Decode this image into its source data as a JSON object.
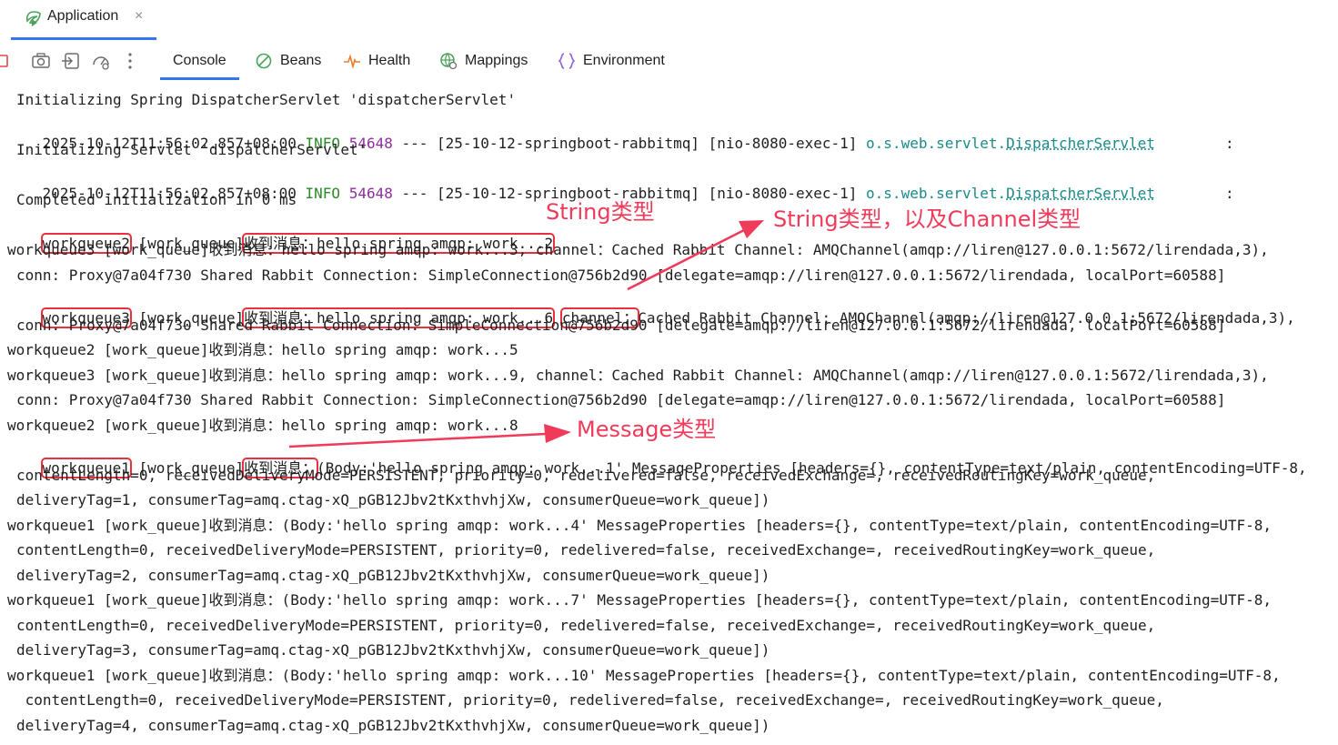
{
  "app_tab": {
    "title": "Application",
    "close": "×"
  },
  "tabs": [
    {
      "label": "Console",
      "icon": "none"
    },
    {
      "label": "Beans",
      "icon": "beans-icon"
    },
    {
      "label": "Health",
      "icon": "health-icon"
    },
    {
      "label": "Mappings",
      "icon": "mappings-icon"
    },
    {
      "label": "Environment",
      "icon": "environment-icon"
    }
  ],
  "colors": {
    "accent": "#3574f0",
    "info": "#2a8a2a",
    "pid": "#8e2f9e",
    "logger": "#1b8a8a",
    "highlight": "#e8313f",
    "annotation": "#f03a5a"
  },
  "console": {
    "l0": "Initializing Spring DispatcherServlet 'dispatcherServlet'",
    "log1": {
      "ts": "2025-10-12T11:56:02.857+08:00",
      "level": " INFO",
      "pid": " 54648",
      "mid": " --- [25-10-12-springboot-rabbitmq] [nio-8080-exec-1] ",
      "logger_pkg": "o.s.web.servlet.",
      "logger_cls": "DispatcherServlet",
      "colon": "        :"
    },
    "l2": "Initializing Servlet 'dispatcherServlet'",
    "log2": {
      "ts": "2025-10-12T11:56:02.857+08:00",
      "level": " INFO",
      "pid": " 54648",
      "mid": " --- [25-10-12-springboot-rabbitmq] [nio-8080-exec-1] ",
      "logger_pkg": "o.s.web.servlet.",
      "logger_cls": "DispatcherServlet",
      "colon": "        :"
    },
    "l4": "Completed initialization in 0 ms",
    "l5": {
      "a": "workqueue2",
      "b": " [work_queue]",
      "c": "收到消息：hello spring amqp: work...2"
    },
    "l6": "workqueue3 [work_queue]收到消息：hello spring amqp: work...3, channel：Cached Rabbit Channel: AMQChannel(amqp://liren@127.0.0.1:5672/lirendada,3),",
    "l7": "conn: Proxy@7a04f730 Shared Rabbit Connection: SimpleConnection@756b2d90 [delegate=amqp://liren@127.0.0.1:5672/lirendada, localPort=60588]",
    "l8": {
      "a": "workqueue3",
      "b": " [work_queue]",
      "c": "收到消息：hello spring amqp: work...6",
      "d": " ",
      "e": "channel：",
      "f": "Cached Rabbit Channel: AMQChannel(amqp://liren@127.0.0.1:5672/lirendada,3),"
    },
    "l9": "conn: Proxy@7a04f730 Shared Rabbit Connection: SimpleConnection@756b2d90 [delegate=amqp://liren@127.0.0.1:5672/lirendada, localPort=60588]",
    "l10": "workqueue2 [work_queue]收到消息：hello spring amqp: work...5",
    "l11": "workqueue3 [work_queue]收到消息：hello spring amqp: work...9, channel：Cached Rabbit Channel: AMQChannel(amqp://liren@127.0.0.1:5672/lirendada,3),",
    "l12": "conn: Proxy@7a04f730 Shared Rabbit Connection: SimpleConnection@756b2d90 [delegate=amqp://liren@127.0.0.1:5672/lirendada, localPort=60588]",
    "l13": "workqueue2 [work_queue]收到消息：hello spring amqp: work...8",
    "l14": {
      "a": "workqueue1",
      "b": " [work_queue]",
      "c": "收到消息：",
      "d": "(Body:'hello spring amqp: work...1' MessageProperties [headers={}, contentType=text/plain, contentEncoding=UTF-8,"
    },
    "l15": "contentLength=0, receivedDeliveryMode=PERSISTENT, priority=0, redelivered=false, receivedExchange=, receivedRoutingKey=work_queue,",
    "l16": "deliveryTag=1, consumerTag=amq.ctag-xQ_pGB12Jbv2tKxthvhjXw, consumerQueue=work_queue])",
    "l17": "workqueue1 [work_queue]收到消息：(Body:'hello spring amqp: work...4' MessageProperties [headers={}, contentType=text/plain, contentEncoding=UTF-8,",
    "l18": "contentLength=0, receivedDeliveryMode=PERSISTENT, priority=0, redelivered=false, receivedExchange=, receivedRoutingKey=work_queue,",
    "l19": "deliveryTag=2, consumerTag=amq.ctag-xQ_pGB12Jbv2tKxthvhjXw, consumerQueue=work_queue])",
    "l20": "workqueue1 [work_queue]收到消息：(Body:'hello spring amqp: work...7' MessageProperties [headers={}, contentType=text/plain, contentEncoding=UTF-8,",
    "l21": "contentLength=0, receivedDeliveryMode=PERSISTENT, priority=0, redelivered=false, receivedExchange=, receivedRoutingKey=work_queue,",
    "l22": "deliveryTag=3, consumerTag=amq.ctag-xQ_pGB12Jbv2tKxthvhjXw, consumerQueue=work_queue])",
    "l23": "workqueue1 [work_queue]收到消息：(Body:'hello spring amqp: work...10' MessageProperties [headers={}, contentType=text/plain, contentEncoding=UTF-8,",
    "l24": " contentLength=0, receivedDeliveryMode=PERSISTENT, priority=0, redelivered=false, receivedExchange=, receivedRoutingKey=work_queue,",
    "l25": "deliveryTag=4, consumerTag=amq.ctag-xQ_pGB12Jbv2tKxthvhjXw, consumerQueue=work_queue])"
  },
  "annotations": {
    "string_type": "String类型",
    "string_channel_type": "String类型，以及Channel类型",
    "message_type": "Message类型"
  }
}
